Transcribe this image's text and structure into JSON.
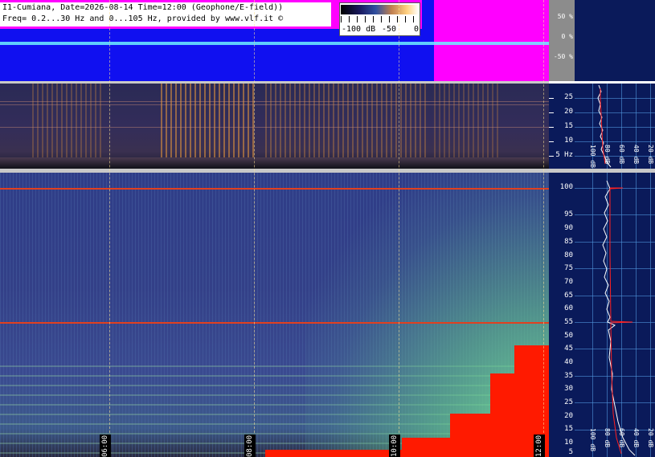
{
  "header": {
    "line1": "I1-Cumiana, Date=2026-08-14 Time=12:00 (Geophone/E-field))",
    "line2": "Freq= 0.2...30 Hz and 0...105 Hz, provided by www.vlf.it ©"
  },
  "colorbar": {
    "min_label": "-100 dB",
    "mid_label": "-50",
    "max_label": "0",
    "colors": [
      "#000000",
      "#1a1a60",
      "#3050a0",
      "#c08050",
      "#ffd080",
      "#ffffff"
    ]
  },
  "amplitude_scale": [
    "50 %",
    "0 %",
    "-50 %"
  ],
  "low_freq_scale": [
    "25",
    "20",
    "15",
    "10",
    "5 Hz"
  ],
  "high_freq_scale": [
    "100",
    "95",
    "90",
    "85",
    "80",
    "75",
    "70",
    "65",
    "60",
    "55",
    "50",
    "45",
    "40",
    "35",
    "30",
    "25",
    "20",
    "15",
    "10",
    "5"
  ],
  "time_labels": [
    "06:00",
    "08:00",
    "10:00",
    "12:00"
  ],
  "spectrum_db_labels": [
    "100 dB",
    "80 dB",
    "60 dB",
    "40 dB",
    "20 dB"
  ],
  "colors": {
    "amplitude_bg": "#1010f0",
    "amplitude_clip": "#ff00ff",
    "trace": "#6ff0ff",
    "panel_bg": "#0a1a5a",
    "intense": "#ff1a00"
  }
}
